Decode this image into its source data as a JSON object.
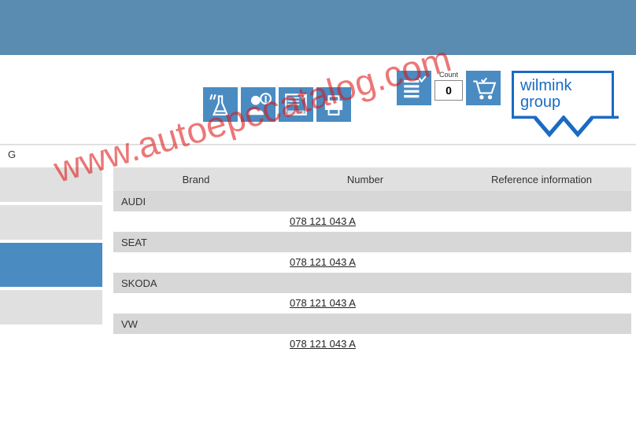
{
  "toolbar": {
    "count_label": "Count",
    "count_value": "0"
  },
  "logo": {
    "line1": "wilmink",
    "line2": "group"
  },
  "sub_letter": "G",
  "table": {
    "headers": {
      "brand": "Brand",
      "number": "Number",
      "ref": "Reference information"
    },
    "groups": [
      {
        "brand": "AUDI",
        "number": "078 121 043 A"
      },
      {
        "brand": "SEAT",
        "number": "078 121 043 A"
      },
      {
        "brand": "SKODA",
        "number": "078 121 043 A"
      },
      {
        "brand": "VW",
        "number": "078 121 043 A"
      }
    ]
  },
  "watermark": "www.autoepccatalog.com"
}
